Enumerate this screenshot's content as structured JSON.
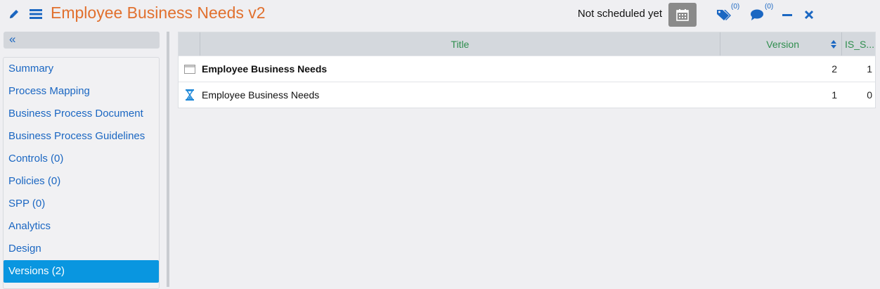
{
  "header": {
    "title": "Employee Business Needs v2",
    "schedule_status": "Not scheduled yet",
    "tag_count": "(0)",
    "comment_count": "(0)"
  },
  "sidebar": {
    "collapse_label": "«",
    "items": [
      {
        "label": "Summary"
      },
      {
        "label": "Process Mapping"
      },
      {
        "label": "Business Process Document"
      },
      {
        "label": "Business Process Guidelines"
      },
      {
        "label": "Controls (0)"
      },
      {
        "label": "Policies (0)"
      },
      {
        "label": "SPP (0)"
      },
      {
        "label": "Analytics"
      },
      {
        "label": "Design"
      },
      {
        "label": "Versions (2)",
        "active": true
      }
    ]
  },
  "grid": {
    "columns": {
      "title": "Title",
      "version": "Version",
      "is_s": "IS_S..."
    },
    "rows": [
      {
        "icon": "window-icon",
        "title": "Employee Business Needs",
        "version": "2",
        "is_s": "1"
      },
      {
        "icon": "hourglass-icon",
        "title": "Employee Business Needs",
        "version": "1",
        "is_s": "0"
      }
    ]
  },
  "colors": {
    "accent": "#e1702e",
    "link": "#1b67c2",
    "active": "#0996e0",
    "header_text": "#2f8e4e"
  }
}
